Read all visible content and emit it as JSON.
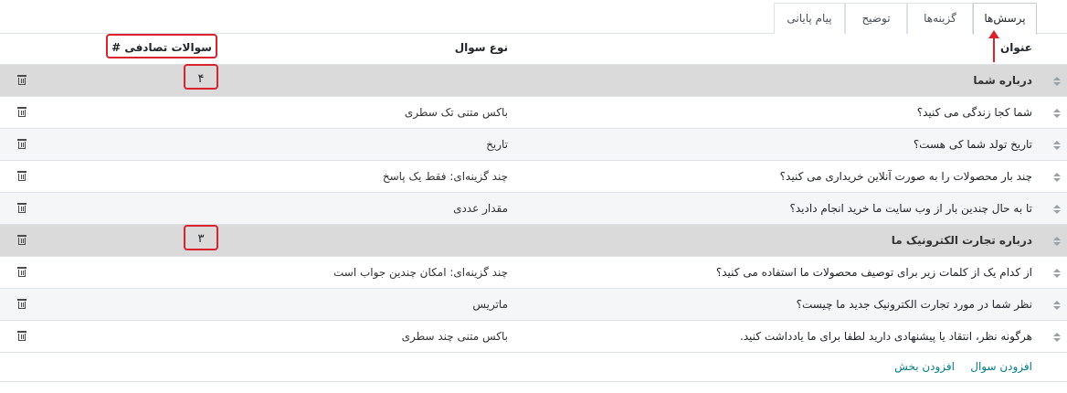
{
  "tabs": [
    {
      "label": "پرسش‌ها",
      "active": true
    },
    {
      "label": "گزینه‌ها",
      "active": false
    },
    {
      "label": "توضیح",
      "active": false
    },
    {
      "label": "پیام پایانی",
      "active": false
    }
  ],
  "table": {
    "headers": {
      "title": "عنوان",
      "question_type": "نوع سوال",
      "random_questions": "# سوالات تصادفی"
    },
    "rows": [
      {
        "kind": "section",
        "title": "درباره شما",
        "question_type": "",
        "count": "۴"
      },
      {
        "kind": "question",
        "title": "شما کجا زندگی می کنید؟",
        "question_type": "باکس متنی تک سطری",
        "count": ""
      },
      {
        "kind": "question",
        "title": "تاریخ تولد شما کی هست؟",
        "question_type": "تاریخ",
        "count": ""
      },
      {
        "kind": "question",
        "title": "چند بار محصولات را به صورت آنلاین خریداری می کنید؟",
        "question_type": "چند گزینه‌ای: فقط یک پاسخ",
        "count": ""
      },
      {
        "kind": "question",
        "title": "تا به حال چندین بار از وب سایت ما خرید انجام دادید؟",
        "question_type": "مقدار عددی",
        "count": ""
      },
      {
        "kind": "section",
        "title": "درباره تجارت الکترونیک ما",
        "question_type": "",
        "count": "۳"
      },
      {
        "kind": "question",
        "title": "از کدام یک از کلمات زیر برای توصیف محصولات ما استفاده می کنید؟",
        "question_type": "چند گزینه‌ای: امکان چندین جواب است",
        "count": ""
      },
      {
        "kind": "question",
        "title": "نظر شما در مورد تجارت الکترونیک جدید ما چیست؟",
        "question_type": "ماتریس",
        "count": ""
      },
      {
        "kind": "question",
        "title": "هرگونه نظر، انتقاد یا پیشنهادی دارید لطفا برای ما یادداشت کنید.",
        "question_type": "باکس متنی چند سطری",
        "count": ""
      }
    ]
  },
  "footer": {
    "add_question": "افزودن سوال",
    "add_section": "افزودن بخش"
  },
  "icons": {
    "row_handle": "sort-handle-icon",
    "delete": "trash-icon"
  },
  "colors": {
    "link": "#017e84",
    "highlight": "#d9232d",
    "section_bg": "#dadada"
  }
}
